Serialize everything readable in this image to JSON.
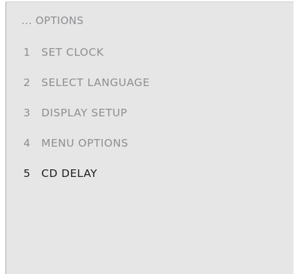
{
  "menu": {
    "header": "... OPTIONS",
    "items": [
      {
        "number": "1",
        "label": "SET CLOCK",
        "selected": false
      },
      {
        "number": "2",
        "label": "SELECT LANGUAGE",
        "selected": false
      },
      {
        "number": "3",
        "label": "DISPLAY SETUP",
        "selected": false
      },
      {
        "number": "4",
        "label": "MENU OPTIONS",
        "selected": false
      },
      {
        "number": "5",
        "label": "CD DELAY",
        "selected": true
      }
    ]
  },
  "colors": {
    "panel_background": "#e6e6e7",
    "inactive_text": "#8e8e91",
    "selected_text": "#1c1c1e"
  }
}
